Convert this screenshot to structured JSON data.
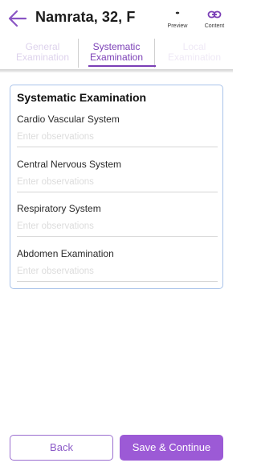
{
  "header": {
    "patient": "Namrata, 32, F",
    "preview_label": "Preview",
    "content_label": "Content"
  },
  "tabs": [
    {
      "line1": "General",
      "line2": "Examination",
      "active": false
    },
    {
      "line1": "Systematic",
      "line2": "Examination",
      "active": true
    },
    {
      "line1": "Local",
      "line2": "Examination",
      "active": false
    }
  ],
  "section": {
    "title": "Systematic Examination",
    "fields": [
      {
        "label": "Cardio Vascular System",
        "placeholder": "Enter observations",
        "value": ""
      },
      {
        "label": "Central Nervous System",
        "placeholder": "Enter observations",
        "value": ""
      },
      {
        "label": "Respiratory System",
        "placeholder": "Enter observations",
        "value": ""
      },
      {
        "label": "Abdomen Examination",
        "placeholder": "Enter observations",
        "value": ""
      }
    ]
  },
  "footer": {
    "back_label": "Back",
    "save_label": "Save & Continue"
  },
  "colors": {
    "accent": "#9c5ad6",
    "accent_dark": "#7b3fb6",
    "card_border": "#a9c3ea"
  },
  "icons": {
    "back": "arrow-left-icon",
    "preview": "eye-icon",
    "content": "link-icon"
  }
}
